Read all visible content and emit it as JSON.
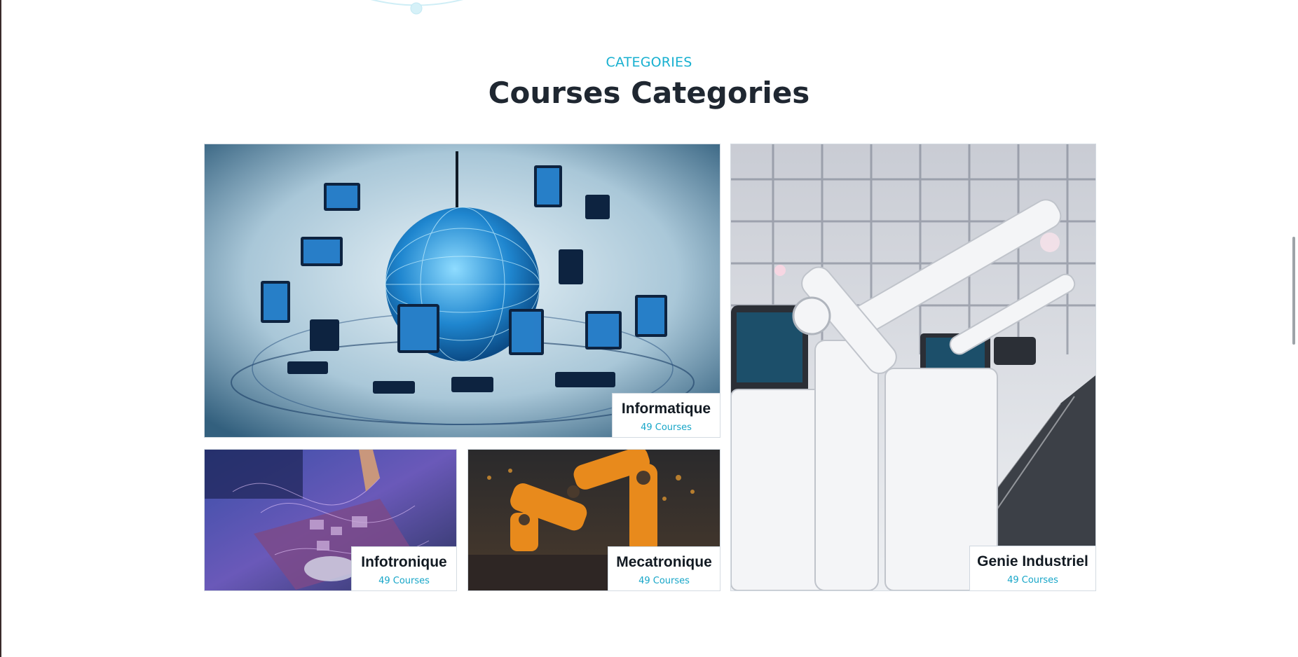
{
  "section": {
    "label": "CATEGORIES",
    "title": "Courses Categories"
  },
  "categories": [
    {
      "name": "Informatique",
      "count": "49 Courses",
      "image": "computer-network-globe-image"
    },
    {
      "name": "Infotronique",
      "count": "49 Courses",
      "image": "circuit-board-soldering-image"
    },
    {
      "name": "Mecatronique",
      "count": "49 Courses",
      "image": "orange-robot-arm-image"
    },
    {
      "name": "Genie Industriel",
      "count": "49 Courses",
      "image": "white-industrial-robots-image"
    }
  ],
  "colors": {
    "accent": "#17b0d0",
    "title": "#1f2731",
    "caption_text": "#121a22",
    "count_text": "#17a6c8"
  }
}
